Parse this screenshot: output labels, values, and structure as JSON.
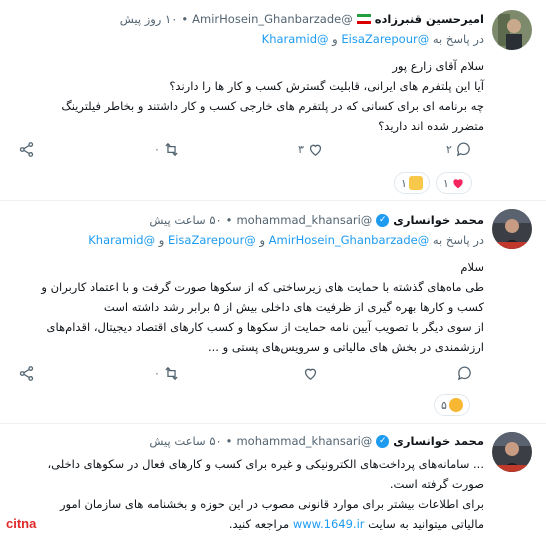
{
  "posts": [
    {
      "author_name": "امیرحسین قنبرزاده",
      "handle": "@AmirHosein_Ghanbarzade",
      "time": "۱۰ روز پیش",
      "reply_prefix": "در پاسخ به",
      "reply_mention_1": "@EisaZarepour",
      "reply_conj": "و",
      "reply_mention_2": "@Kharamid",
      "body": [
        "سلام آقای زارع پور",
        "آیا این پلتفرم های ایرانی، قابلیت گسترش کسب و کار ها را دارند؟",
        "چه برنامه ای برای کسانی که در پلتفرم های خارجی کسب و کار داشتند و بخاطر فیلترینگ",
        "متضرر شده اند دارید؟"
      ],
      "reply_count": "۲",
      "like_count": "۳",
      "retweet_count": "۰",
      "reactions": [
        {
          "emoji": "heart",
          "count": "۱"
        },
        {
          "emoji": "thumbs-up",
          "count": "۱"
        }
      ]
    },
    {
      "author_name": "محمد خوانساری",
      "handle": "@mohammad_khansari",
      "time": "۵۰ ساعت پیش",
      "reply_prefix": "در پاسخ به",
      "reply_mention_1": "@AmirHosein_Ghanbarzade",
      "reply_conj_1": "و",
      "reply_mention_2": "@EisaZarepour",
      "reply_conj_2": "و",
      "reply_mention_3": "@Kharamid",
      "body": [
        "سلام",
        "طی ماه‌های گذشته با حمایت های زیرساختی که از سکوها صورت گرفت و با اعتماد کاربران و",
        "کسب و کارها بهره گیری از ظرفیت های داخلی بیش از ۵ برابر رشد داشته است",
        "از سوی دیگر با تصویب آیین نامه حمایت از سکوها و کسب کارهای اقتصاد دیجیتال، اقدام‌های",
        "ارزشمندی در بخش های مالیاتی و سرویس‌های پستی و ..."
      ],
      "retweet_count": "۰",
      "reactions": [
        {
          "emoji": "clapping",
          "count": "۵"
        }
      ]
    },
    {
      "author_name": "محمد خوانساری",
      "handle": "@mohammad_khansari",
      "time": "۵۰ ساعت پیش",
      "body": [
        "... سامانه‌های پرداخت‌های الکترونیکی و غیره برای کسب و کارهای فعال در سکوهای داخلی،",
        "صورت گرفته است.",
        "برای اطلاعات بیشتر برای موارد قانونی مصوب در این حوزه و بخشنامه های سازمان امور",
        "مالیاتی میتوانید به سایت",
        "www.1649.ir",
        "مراجعه کنید."
      ]
    }
  ],
  "logo_text": "citna",
  "colors": {
    "accent": "#1d9bf0",
    "muted": "#536471",
    "divider": "#eff3f4",
    "logo_red": "#e02a2a"
  }
}
